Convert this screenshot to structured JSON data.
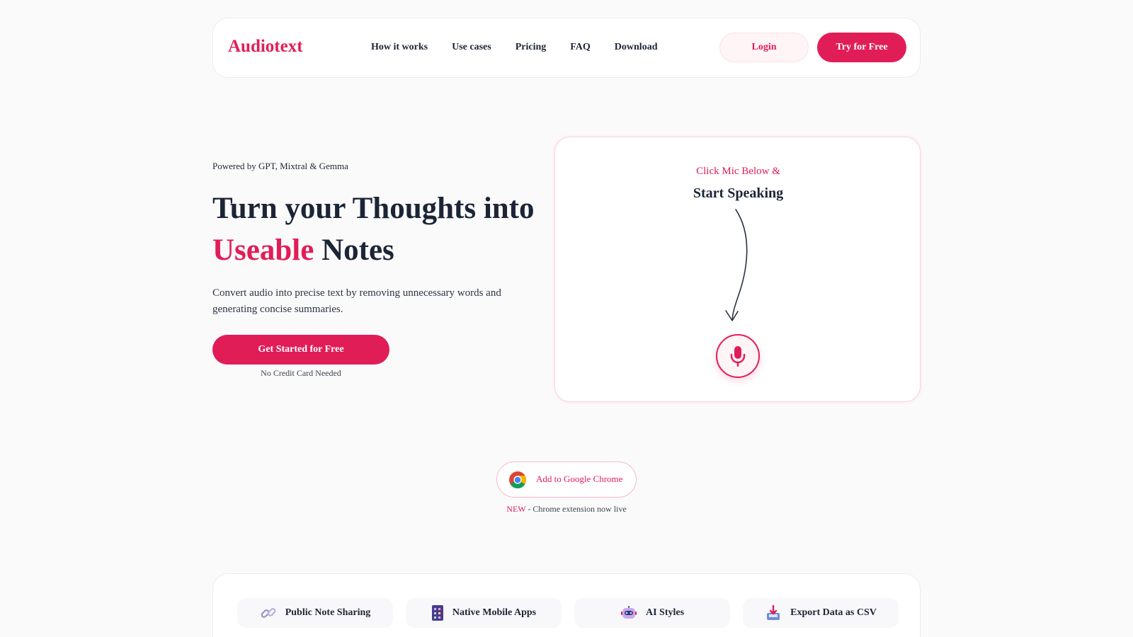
{
  "header": {
    "logo": "Audiotext",
    "nav": [
      "How it works",
      "Use cases",
      "Pricing",
      "FAQ",
      "Download"
    ],
    "login_label": "Login",
    "try_label": "Try for Free"
  },
  "hero": {
    "powered_by": "Powered by GPT, Mixtral & Gemma",
    "headline_part1": "Turn your Thoughts into",
    "headline_accent": "Useable",
    "headline_part2": "Notes",
    "subtext": "Convert audio into precise text by removing unnecessary words and generating concise summaries.",
    "cta_label": "Get Started for Free",
    "cta_note": "No Credit Card Needed"
  },
  "mic_card": {
    "prompt_line1": "Click Mic Below &",
    "prompt_line2": "Start Speaking",
    "mic_icon": "microphone-icon"
  },
  "chrome": {
    "label": "Add to Google Chrome",
    "new_tag": "NEW",
    "new_text": " - Chrome extension now live",
    "icon": "chrome-icon"
  },
  "features": [
    {
      "label": "Public Note Sharing",
      "icon": "link-icon"
    },
    {
      "label": "Native Mobile Apps",
      "icon": "mobile-apps-icon"
    },
    {
      "label": "AI Styles",
      "icon": "robot-icon"
    },
    {
      "label": "Export Data as CSV",
      "icon": "export-icon"
    }
  ],
  "colors": {
    "accent": "#e11d58",
    "text": "#1c2536",
    "background": "#fbfafb"
  }
}
